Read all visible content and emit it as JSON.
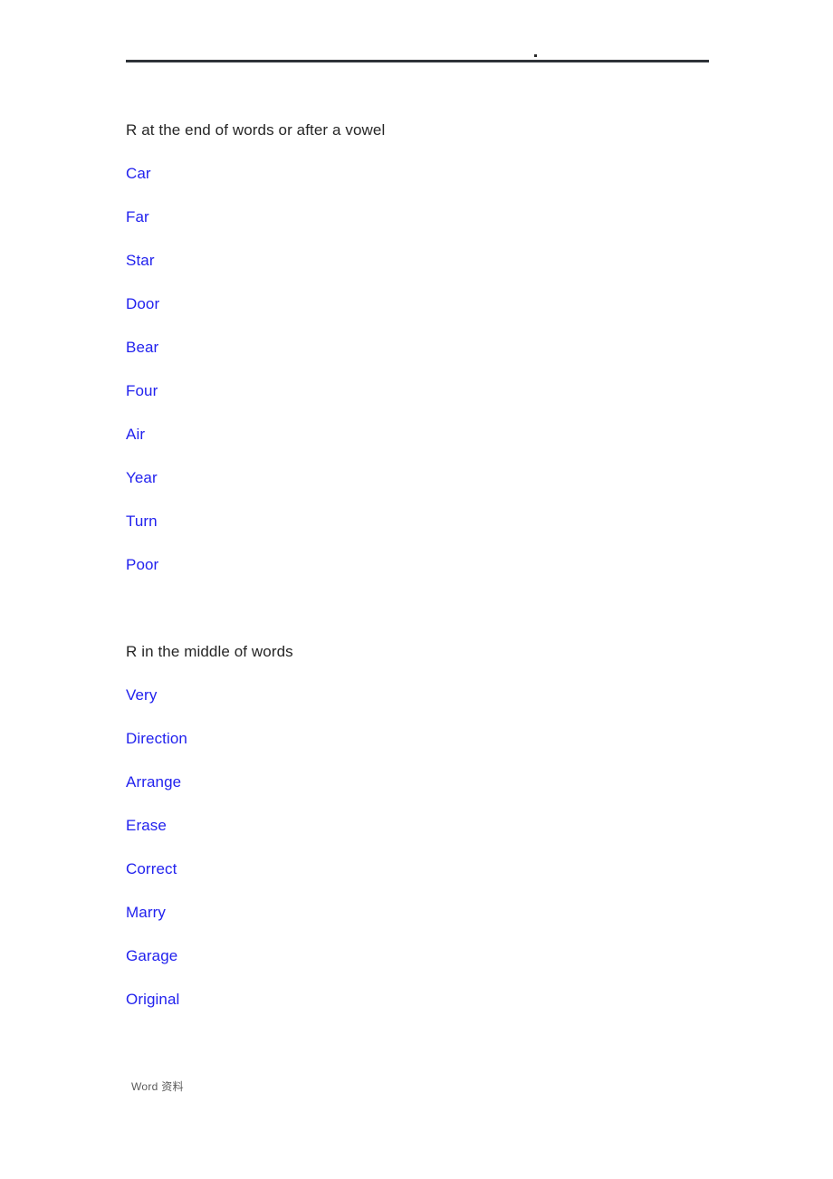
{
  "document": {
    "header": {
      "dot_mark": "·",
      "rule_color": "#2e3238"
    },
    "sections": [
      {
        "heading": "R at the end of words or after a vowel",
        "words": [
          "Car",
          "Far",
          "Star",
          "Door",
          "Bear",
          "Four",
          "Air",
          "Year",
          "Turn",
          "Poor"
        ]
      },
      {
        "heading": "R in the middle of words",
        "words": [
          "Very",
          "Direction",
          "Arrange",
          "Erase",
          "Correct",
          "Marry",
          "Garage",
          "Original"
        ]
      }
    ],
    "footer": {
      "text": "Word 资料"
    },
    "colors": {
      "word_blue": "#2222ee",
      "heading_dark": "#262626",
      "footer_gray": "#5a5a5a",
      "rule": "#2e3238",
      "page_background": "#ffffff"
    }
  }
}
